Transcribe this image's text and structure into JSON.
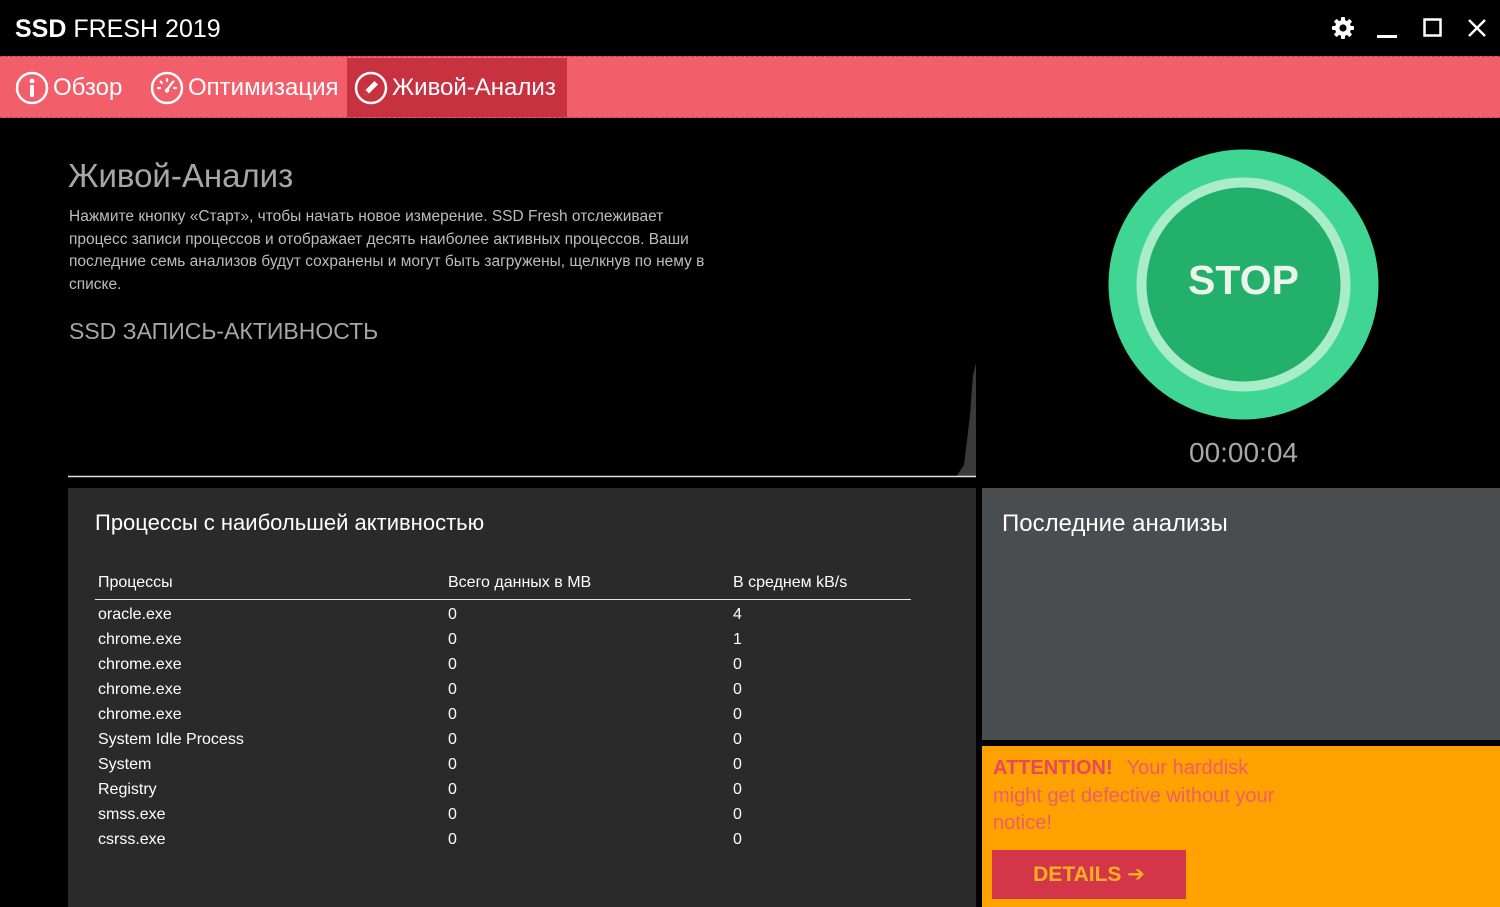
{
  "window": {
    "title_brand": "SSD",
    "title_rest": "FRESH 2019",
    "controls": [
      "gear-icon",
      "minimize-icon",
      "maximize-icon",
      "close-icon"
    ]
  },
  "tabs": [
    {
      "label": "Обзор",
      "icon": "info-icon",
      "active": false
    },
    {
      "label": "Оптимизация",
      "icon": "speedometer-icon",
      "active": false
    },
    {
      "label": "Живой-Анализ",
      "icon": "pencil-icon",
      "active": true
    }
  ],
  "main": {
    "title": "Живой-Анализ",
    "description": "Нажмите кнопку «Старт», чтобы начать новое измерение. SSD Fresh отслеживает процесс записи процессов и отображает десять наиболее активных процессов. Ваши последние семь анализов будут сохранены и могут быть загружены, щелкнув по нему в списке.",
    "section_title": "SSD ЗАПИСЬ-АКТИВНОСТЬ"
  },
  "stop": {
    "label": "STOP",
    "timer": "00:00:04"
  },
  "processes": {
    "title": "Процессы с наибольшей активностью",
    "headers": {
      "name": "Процессы",
      "total": "Всего данных в MB",
      "avg": "В среднем kB/s"
    },
    "rows": [
      {
        "name": "oracle.exe",
        "total": "0",
        "avg": "4"
      },
      {
        "name": "chrome.exe",
        "total": "0",
        "avg": "1"
      },
      {
        "name": "chrome.exe",
        "total": "0",
        "avg": "0"
      },
      {
        "name": "chrome.exe",
        "total": "0",
        "avg": "0"
      },
      {
        "name": "chrome.exe",
        "total": "0",
        "avg": "0"
      },
      {
        "name": "System Idle Process",
        "total": "0",
        "avg": "0"
      },
      {
        "name": "System",
        "total": "0",
        "avg": "0"
      },
      {
        "name": "Registry",
        "total": "0",
        "avg": "0"
      },
      {
        "name": "smss.exe",
        "total": "0",
        "avg": "0"
      },
      {
        "name": "csrss.exe",
        "total": "0",
        "avg": "0"
      }
    ]
  },
  "recent": {
    "title": "Последние анализы"
  },
  "attention": {
    "strong": "ATTENTION!",
    "text": "Your harddisk might get defective without your notice!",
    "button": "DETAILS ➔"
  },
  "colors": {
    "tab_bar": "#f25e6a",
    "tab_active": "#c8313f",
    "stop_green": "#22b06b",
    "stop_ring": "#3fd592",
    "attention_bg": "#ffa200",
    "details_btn": "#d33648"
  }
}
